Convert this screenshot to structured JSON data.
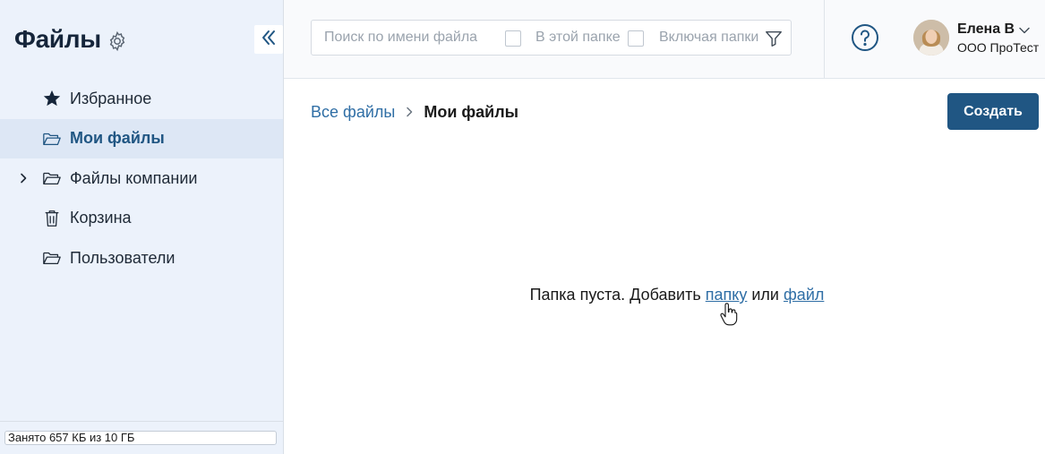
{
  "sidebar": {
    "title": "Файлы",
    "items": [
      {
        "label": "Избранное",
        "icon": "star-icon"
      },
      {
        "label": "Мои файлы",
        "icon": "folder-open-icon",
        "active": true
      },
      {
        "label": "Файлы компании",
        "icon": "folder-open-icon",
        "expandable": true
      },
      {
        "label": "Корзина",
        "icon": "trash-icon"
      },
      {
        "label": "Пользователи",
        "icon": "folder-open-icon"
      }
    ],
    "storage": {
      "text": "Занято 657 КБ из 10 ГБ",
      "used_fraction": 0.0001
    }
  },
  "search": {
    "placeholder": "Поиск по имени файла",
    "in_this_folder_label": "В этой папке",
    "include_folders_label": "Включая папки"
  },
  "user": {
    "name": "Елена В",
    "org": "ООО ПроТест"
  },
  "breadcrumb": {
    "root": "Все файлы",
    "current": "Мои файлы"
  },
  "actions": {
    "create_label": "Создать"
  },
  "empty_state": {
    "prefix": "Папка пуста. Добавить",
    "folder_link": "папку",
    "middle": "или",
    "file_link": "файл"
  },
  "colors": {
    "accent": "#205683",
    "link": "#2f6ea5",
    "sidebar_bg": "#ecf2fb",
    "active_item_bg": "#dde7f5"
  }
}
